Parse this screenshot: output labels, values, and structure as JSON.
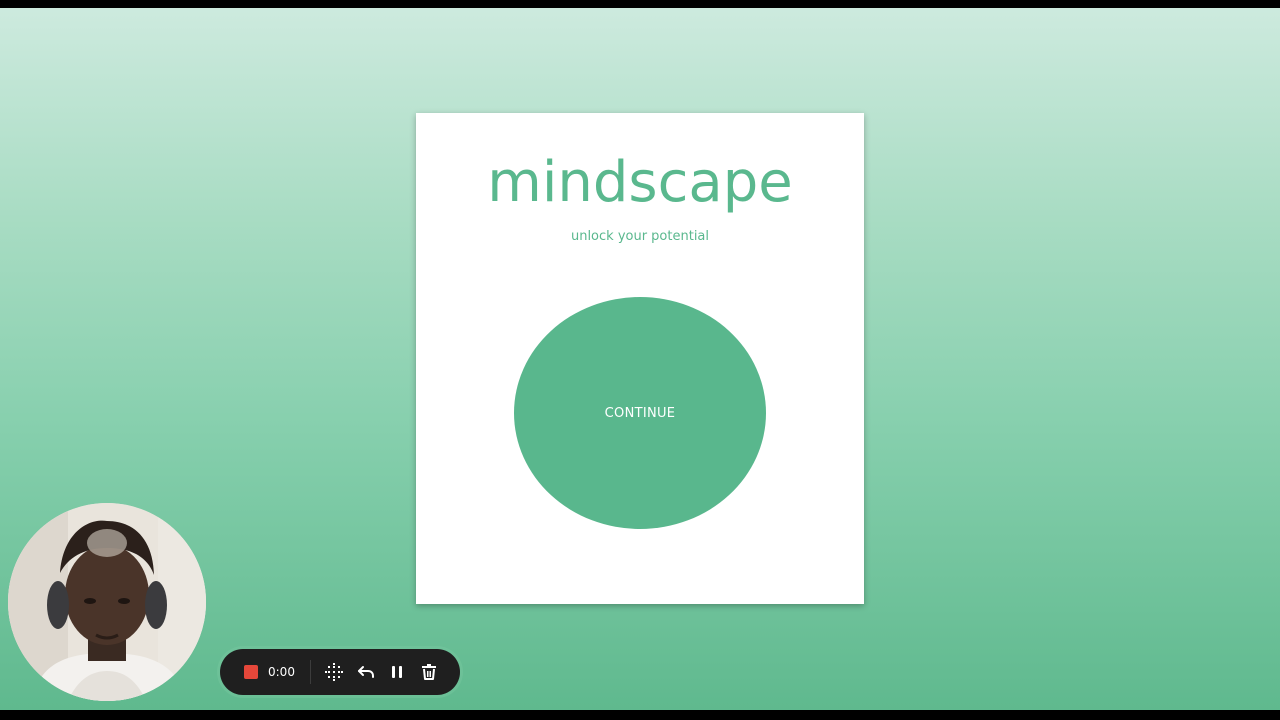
{
  "app": {
    "title": "mindscape",
    "tagline": "unlock your potential",
    "continue_label": "CONTINUE"
  },
  "recorder": {
    "timer": "0:00",
    "icons": [
      "stop-icon",
      "grid-icon",
      "undo-icon",
      "pause-icon",
      "trash-icon"
    ]
  },
  "colors": {
    "brand_green": "#5ab88e",
    "record_red": "#e5473a",
    "toolbar_bg": "#1f1f1f"
  }
}
